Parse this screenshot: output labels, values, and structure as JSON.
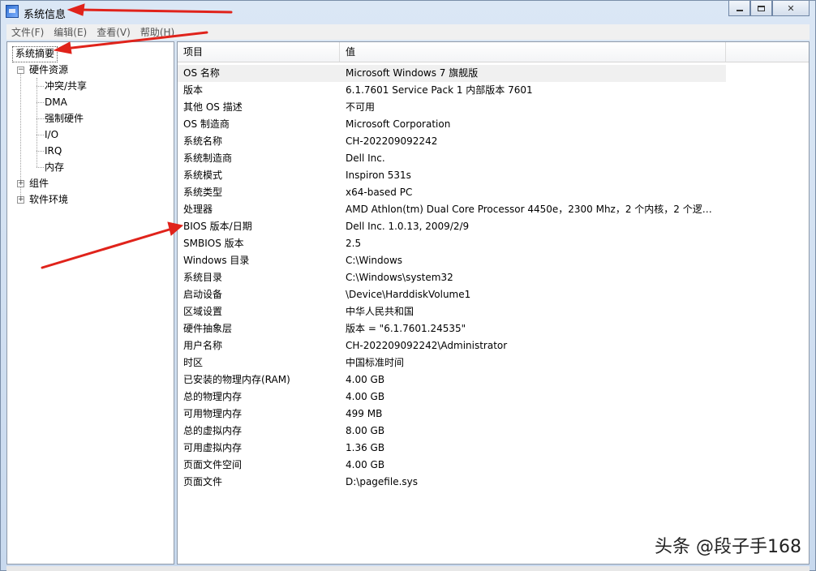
{
  "window": {
    "title": "系统信息"
  },
  "menu": [
    {
      "label": "文件(F)"
    },
    {
      "label": "编辑(E)"
    },
    {
      "label": "查看(V)"
    },
    {
      "label": "帮助(H)"
    }
  ],
  "tree": {
    "root": "系统摘要",
    "hardware": "硬件资源",
    "hardware_children": [
      "冲突/共享",
      "DMA",
      "强制硬件",
      "I/O",
      "IRQ",
      "内存"
    ],
    "components": "组件",
    "software": "软件环境"
  },
  "table": {
    "columns": [
      "项目",
      "值"
    ],
    "rows": [
      {
        "k": "OS 名称",
        "v": "Microsoft Windows 7 旗舰版"
      },
      {
        "k": "版本",
        "v": "6.1.7601 Service Pack 1 内部版本 7601"
      },
      {
        "k": "其他 OS 描述",
        "v": "不可用"
      },
      {
        "k": "OS 制造商",
        "v": "Microsoft Corporation"
      },
      {
        "k": "系统名称",
        "v": "CH-202209092242"
      },
      {
        "k": "系统制造商",
        "v": "Dell Inc."
      },
      {
        "k": "系统模式",
        "v": "Inspiron 531s"
      },
      {
        "k": "系统类型",
        "v": "x64-based PC"
      },
      {
        "k": "处理器",
        "v": "AMD Athlon(tm) Dual Core Processor 4450e，2300 Mhz，2 个内核，2 个逻辑..."
      },
      {
        "k": "BIOS 版本/日期",
        "v": "Dell Inc. 1.0.13, 2009/2/9"
      },
      {
        "k": "SMBIOS 版本",
        "v": "2.5"
      },
      {
        "k": "Windows 目录",
        "v": "C:\\Windows"
      },
      {
        "k": "系统目录",
        "v": "C:\\Windows\\system32"
      },
      {
        "k": "启动设备",
        "v": "\\Device\\HarddiskVolume1"
      },
      {
        "k": "区域设置",
        "v": "中华人民共和国"
      },
      {
        "k": "硬件抽象层",
        "v": "版本 = \"6.1.7601.24535\""
      },
      {
        "k": "用户名称",
        "v": "CH-202209092242\\Administrator"
      },
      {
        "k": "时区",
        "v": "中国标准时间"
      },
      {
        "k": "已安装的物理内存(RAM)",
        "v": "4.00 GB"
      },
      {
        "k": "总的物理内存",
        "v": "4.00 GB"
      },
      {
        "k": "可用物理内存",
        "v": "499 MB"
      },
      {
        "k": "总的虚拟内存",
        "v": "8.00 GB"
      },
      {
        "k": "可用虚拟内存",
        "v": "1.36 GB"
      },
      {
        "k": "页面文件空间",
        "v": "4.00 GB"
      },
      {
        "k": "页面文件",
        "v": "D:\\pagefile.sys"
      }
    ]
  },
  "watermark": "头条 @段子手168",
  "colors": {
    "arrow": "#e0231b",
    "selected_row": "#f0f0f0"
  },
  "icons": {
    "app": "system-info-icon",
    "close": "close-icon",
    "maximize": "maximize-icon",
    "minimize": "minimize-icon"
  }
}
